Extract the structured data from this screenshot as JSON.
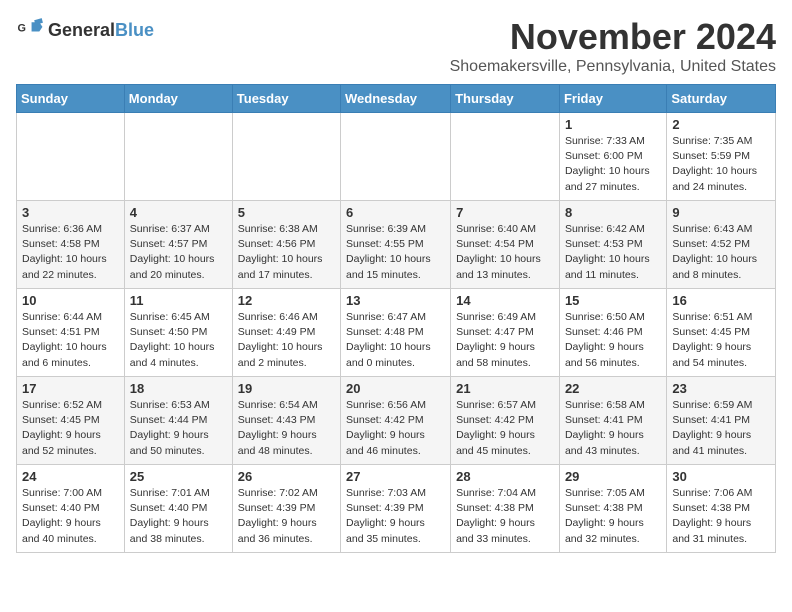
{
  "logo": {
    "general": "General",
    "blue": "Blue"
  },
  "title": "November 2024",
  "location": "Shoemakersville, Pennsylvania, United States",
  "days_of_week": [
    "Sunday",
    "Monday",
    "Tuesday",
    "Wednesday",
    "Thursday",
    "Friday",
    "Saturday"
  ],
  "weeks": [
    [
      {
        "day": "",
        "info": ""
      },
      {
        "day": "",
        "info": ""
      },
      {
        "day": "",
        "info": ""
      },
      {
        "day": "",
        "info": ""
      },
      {
        "day": "",
        "info": ""
      },
      {
        "day": "1",
        "info": "Sunrise: 7:33 AM\nSunset: 6:00 PM\nDaylight: 10 hours and 27 minutes."
      },
      {
        "day": "2",
        "info": "Sunrise: 7:35 AM\nSunset: 5:59 PM\nDaylight: 10 hours and 24 minutes."
      }
    ],
    [
      {
        "day": "3",
        "info": "Sunrise: 6:36 AM\nSunset: 4:58 PM\nDaylight: 10 hours and 22 minutes."
      },
      {
        "day": "4",
        "info": "Sunrise: 6:37 AM\nSunset: 4:57 PM\nDaylight: 10 hours and 20 minutes."
      },
      {
        "day": "5",
        "info": "Sunrise: 6:38 AM\nSunset: 4:56 PM\nDaylight: 10 hours and 17 minutes."
      },
      {
        "day": "6",
        "info": "Sunrise: 6:39 AM\nSunset: 4:55 PM\nDaylight: 10 hours and 15 minutes."
      },
      {
        "day": "7",
        "info": "Sunrise: 6:40 AM\nSunset: 4:54 PM\nDaylight: 10 hours and 13 minutes."
      },
      {
        "day": "8",
        "info": "Sunrise: 6:42 AM\nSunset: 4:53 PM\nDaylight: 10 hours and 11 minutes."
      },
      {
        "day": "9",
        "info": "Sunrise: 6:43 AM\nSunset: 4:52 PM\nDaylight: 10 hours and 8 minutes."
      }
    ],
    [
      {
        "day": "10",
        "info": "Sunrise: 6:44 AM\nSunset: 4:51 PM\nDaylight: 10 hours and 6 minutes."
      },
      {
        "day": "11",
        "info": "Sunrise: 6:45 AM\nSunset: 4:50 PM\nDaylight: 10 hours and 4 minutes."
      },
      {
        "day": "12",
        "info": "Sunrise: 6:46 AM\nSunset: 4:49 PM\nDaylight: 10 hours and 2 minutes."
      },
      {
        "day": "13",
        "info": "Sunrise: 6:47 AM\nSunset: 4:48 PM\nDaylight: 10 hours and 0 minutes."
      },
      {
        "day": "14",
        "info": "Sunrise: 6:49 AM\nSunset: 4:47 PM\nDaylight: 9 hours and 58 minutes."
      },
      {
        "day": "15",
        "info": "Sunrise: 6:50 AM\nSunset: 4:46 PM\nDaylight: 9 hours and 56 minutes."
      },
      {
        "day": "16",
        "info": "Sunrise: 6:51 AM\nSunset: 4:45 PM\nDaylight: 9 hours and 54 minutes."
      }
    ],
    [
      {
        "day": "17",
        "info": "Sunrise: 6:52 AM\nSunset: 4:45 PM\nDaylight: 9 hours and 52 minutes."
      },
      {
        "day": "18",
        "info": "Sunrise: 6:53 AM\nSunset: 4:44 PM\nDaylight: 9 hours and 50 minutes."
      },
      {
        "day": "19",
        "info": "Sunrise: 6:54 AM\nSunset: 4:43 PM\nDaylight: 9 hours and 48 minutes."
      },
      {
        "day": "20",
        "info": "Sunrise: 6:56 AM\nSunset: 4:42 PM\nDaylight: 9 hours and 46 minutes."
      },
      {
        "day": "21",
        "info": "Sunrise: 6:57 AM\nSunset: 4:42 PM\nDaylight: 9 hours and 45 minutes."
      },
      {
        "day": "22",
        "info": "Sunrise: 6:58 AM\nSunset: 4:41 PM\nDaylight: 9 hours and 43 minutes."
      },
      {
        "day": "23",
        "info": "Sunrise: 6:59 AM\nSunset: 4:41 PM\nDaylight: 9 hours and 41 minutes."
      }
    ],
    [
      {
        "day": "24",
        "info": "Sunrise: 7:00 AM\nSunset: 4:40 PM\nDaylight: 9 hours and 40 minutes."
      },
      {
        "day": "25",
        "info": "Sunrise: 7:01 AM\nSunset: 4:40 PM\nDaylight: 9 hours and 38 minutes."
      },
      {
        "day": "26",
        "info": "Sunrise: 7:02 AM\nSunset: 4:39 PM\nDaylight: 9 hours and 36 minutes."
      },
      {
        "day": "27",
        "info": "Sunrise: 7:03 AM\nSunset: 4:39 PM\nDaylight: 9 hours and 35 minutes."
      },
      {
        "day": "28",
        "info": "Sunrise: 7:04 AM\nSunset: 4:38 PM\nDaylight: 9 hours and 33 minutes."
      },
      {
        "day": "29",
        "info": "Sunrise: 7:05 AM\nSunset: 4:38 PM\nDaylight: 9 hours and 32 minutes."
      },
      {
        "day": "30",
        "info": "Sunrise: 7:06 AM\nSunset: 4:38 PM\nDaylight: 9 hours and 31 minutes."
      }
    ]
  ]
}
